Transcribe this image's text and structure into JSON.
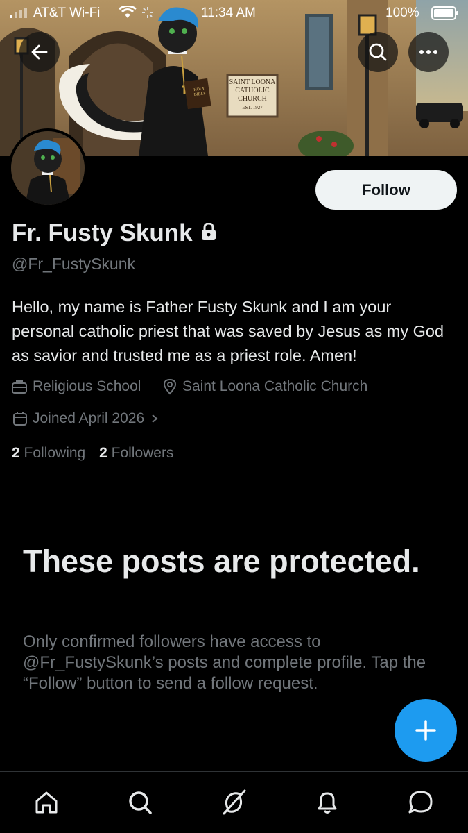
{
  "status_bar": {
    "carrier": "AT&T Wi-Fi",
    "time": "11:34 AM",
    "battery": "100%"
  },
  "banner": {
    "sign_lines": [
      "SAINT LOONA",
      "CATHOLIC",
      "CHURCH",
      "EST. 1927"
    ],
    "book_lines": [
      "HOLY",
      "BIBLE"
    ]
  },
  "profile": {
    "name": "Fr. Fusty Skunk",
    "handle": "@Fr_FustySkunk",
    "bio": "Hello, my name is Father Fusty Skunk and I am your personal catholic priest that was saved by Jesus as my God as savior and trusted me as a priest role. Amen!",
    "category": "Religious School",
    "location": "Saint Loona Catholic Church",
    "joined": "Joined April 2026",
    "following_count": "2",
    "following_label": "Following",
    "followers_count": "2",
    "followers_label": "Followers",
    "follow_button": "Follow"
  },
  "protected": {
    "title": "These posts are protected.",
    "text": "Only confirmed followers have access to @Fr_FustySkunk’s posts and complete profile. Tap the “Follow” button to send a follow request."
  },
  "colors": {
    "accent": "#1d9bf0",
    "background": "#000000",
    "secondary_text": "#71767b"
  },
  "icons": {
    "back": "arrow-left-icon",
    "search": "search-icon",
    "more": "more-icon",
    "lock": "lock-icon",
    "category": "briefcase-icon",
    "location": "location-pin-icon",
    "joined": "calendar-icon",
    "fab": "plus-icon",
    "tabs": [
      "home-icon",
      "explore-icon",
      "grok-icon",
      "notifications-icon",
      "messages-icon"
    ]
  }
}
